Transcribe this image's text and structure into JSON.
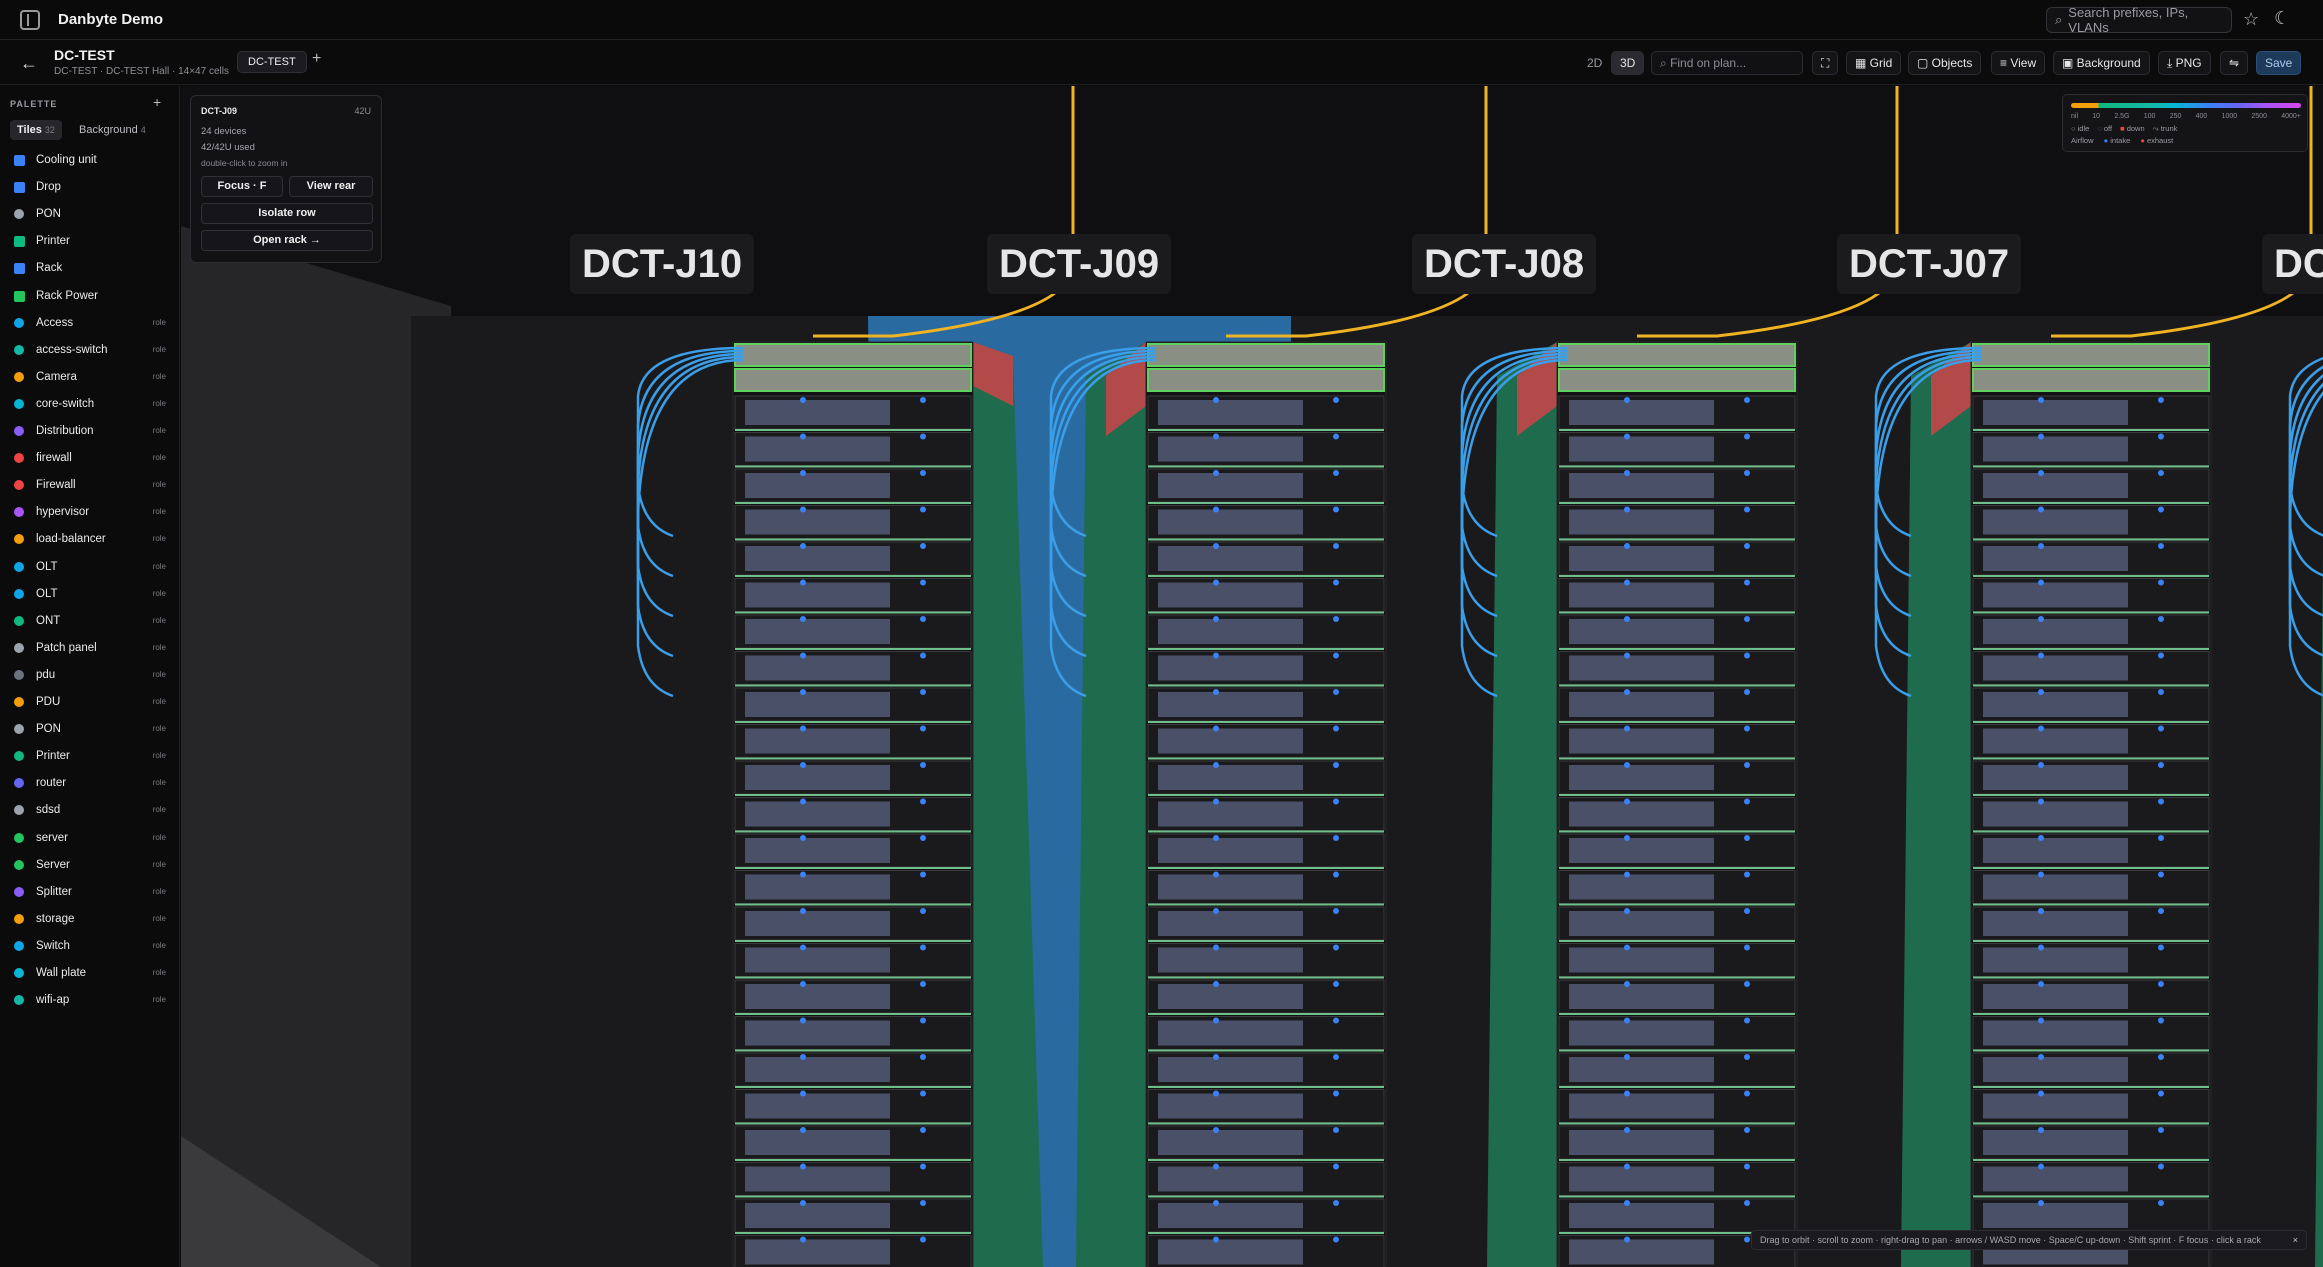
{
  "topbar": {
    "app_title": "Danbyte Demo",
    "search_placeholder": "Search prefixes, IPs, VLANs"
  },
  "header": {
    "title": "DC-TEST",
    "subtitle": "DC-TEST · DC-TEST Hall · 14×47 cells",
    "tab": "DC-TEST",
    "view_2d": "2D",
    "view_3d": "3D",
    "find_placeholder": "Find on plan...",
    "grid": "Grid",
    "objects": "Objects",
    "view": "View",
    "background": "Background",
    "png": "PNG",
    "save": "Save"
  },
  "palette": {
    "heading": "PALETTE",
    "tabs": [
      {
        "label": "Tiles",
        "count": "32"
      },
      {
        "label": "Background",
        "count": "4"
      }
    ],
    "items": [
      {
        "name": "Cooling unit",
        "role": "",
        "icon": "cooling-icon",
        "color": "#3b82f6",
        "shape": "sq"
      },
      {
        "name": "Drop",
        "role": "",
        "icon": "drop-icon",
        "color": "#3b82f6",
        "shape": "sq"
      },
      {
        "name": "PON",
        "role": "",
        "icon": "pon-icon",
        "color": "#9ca3af",
        "shape": "dot"
      },
      {
        "name": "Printer",
        "role": "",
        "icon": "printer-icon",
        "color": "#10b981",
        "shape": "sq"
      },
      {
        "name": "Rack",
        "role": "",
        "icon": "rack-icon",
        "color": "#3b82f6",
        "shape": "sq"
      },
      {
        "name": "Rack Power",
        "role": "",
        "icon": "power-icon",
        "color": "#22c55e",
        "shape": "sq"
      },
      {
        "name": "Access",
        "role": "role",
        "icon": "dot",
        "color": "#0ea5e9",
        "shape": "dot"
      },
      {
        "name": "access-switch",
        "role": "role",
        "icon": "dot",
        "color": "#14b8a6",
        "shape": "dot"
      },
      {
        "name": "Camera",
        "role": "role",
        "icon": "dot",
        "color": "#f59e0b",
        "shape": "dot"
      },
      {
        "name": "core-switch",
        "role": "role",
        "icon": "dot",
        "color": "#06b6d4",
        "shape": "dot"
      },
      {
        "name": "Distribution",
        "role": "role",
        "icon": "dot",
        "color": "#8b5cf6",
        "shape": "dot"
      },
      {
        "name": "firewall",
        "role": "role",
        "icon": "dot",
        "color": "#ef4444",
        "shape": "dot"
      },
      {
        "name": "Firewall",
        "role": "role",
        "icon": "dot",
        "color": "#ef4444",
        "shape": "dot"
      },
      {
        "name": "hypervisor",
        "role": "role",
        "icon": "dot",
        "color": "#a855f7",
        "shape": "dot"
      },
      {
        "name": "load-balancer",
        "role": "role",
        "icon": "dot",
        "color": "#f59e0b",
        "shape": "dot"
      },
      {
        "name": "OLT",
        "role": "role",
        "icon": "dot",
        "color": "#0ea5e9",
        "shape": "dot"
      },
      {
        "name": "OLT",
        "role": "role",
        "icon": "dot",
        "color": "#0ea5e9",
        "shape": "dot"
      },
      {
        "name": "ONT",
        "role": "role",
        "icon": "dot",
        "color": "#10b981",
        "shape": "dot"
      },
      {
        "name": "Patch panel",
        "role": "role",
        "icon": "dot",
        "color": "#9ca3af",
        "shape": "dot"
      },
      {
        "name": "pdu",
        "role": "role",
        "icon": "dot",
        "color": "#6b7280",
        "shape": "dot"
      },
      {
        "name": "PDU",
        "role": "role",
        "icon": "dot",
        "color": "#f59e0b",
        "shape": "dot"
      },
      {
        "name": "PON",
        "role": "role",
        "icon": "dot",
        "color": "#9ca3af",
        "shape": "dot"
      },
      {
        "name": "Printer",
        "role": "role",
        "icon": "dot",
        "color": "#10b981",
        "shape": "dot"
      },
      {
        "name": "router",
        "role": "role",
        "icon": "dot",
        "color": "#6366f1",
        "shape": "dot"
      },
      {
        "name": "sdsd",
        "role": "role",
        "icon": "dot",
        "color": "#9ca3af",
        "shape": "dot"
      },
      {
        "name": "server",
        "role": "role",
        "icon": "dot",
        "color": "#22c55e",
        "shape": "dot"
      },
      {
        "name": "Server",
        "role": "role",
        "icon": "dot",
        "color": "#22c55e",
        "shape": "dot"
      },
      {
        "name": "Splitter",
        "role": "role",
        "icon": "dot",
        "color": "#8b5cf6",
        "shape": "dot"
      },
      {
        "name": "storage",
        "role": "role",
        "icon": "dot",
        "color": "#f59e0b",
        "shape": "dot"
      },
      {
        "name": "Switch",
        "role": "role",
        "icon": "dot",
        "color": "#0ea5e9",
        "shape": "dot"
      },
      {
        "name": "Wall plate",
        "role": "role",
        "icon": "dot",
        "color": "#06b6d4",
        "shape": "dot"
      },
      {
        "name": "wifi-ap",
        "role": "role",
        "icon": "dot",
        "color": "#14b8a6",
        "shape": "dot"
      }
    ]
  },
  "popover": {
    "title": "DCT-J09",
    "units": "42U",
    "devices": "24 devices",
    "used": "42/42U used",
    "hint": "double-click to zoom in",
    "focus": "Focus · F",
    "view_rear": "View rear",
    "isolate": "Isolate row",
    "open_rack": "Open rack →"
  },
  "racks": [
    {
      "label": "DCT-J10"
    },
    {
      "label": "DCT-J09"
    },
    {
      "label": "DCT-J08"
    },
    {
      "label": "DCT-J07"
    },
    {
      "label": "DC"
    }
  ],
  "legend": {
    "ticks": [
      "nil",
      "10",
      "2.5G",
      "100",
      "250",
      "400",
      "1000",
      "2500",
      "4000+"
    ],
    "states": [
      "idle",
      "off",
      "down",
      "trunk"
    ],
    "airflow_label": "Airflow",
    "airflow": [
      "intake",
      "exhaust"
    ],
    "colors": {
      "down": "#ef4444",
      "intake": "#3b82f6",
      "exhaust": "#ef4444"
    }
  },
  "hint": {
    "text": "Drag to orbit · scroll to zoom · right-drag to pan · arrows / WASD move · Space/C up-down · Shift sprint · F focus · click a rack",
    "close": "×"
  }
}
